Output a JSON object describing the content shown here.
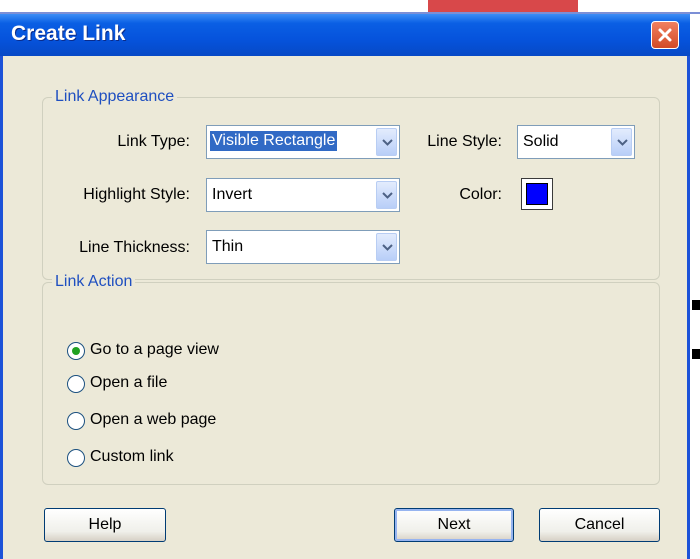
{
  "window": {
    "title": "Create Link"
  },
  "link_appearance": {
    "legend": "Link Appearance",
    "link_type": {
      "label": "Link Type:",
      "value": "Visible Rectangle"
    },
    "line_style": {
      "label": "Line Style:",
      "value": "Solid"
    },
    "highlight_style": {
      "label": "Highlight Style:",
      "value": "Invert"
    },
    "color": {
      "label": "Color:",
      "value": "#0000ff"
    },
    "line_thickness": {
      "label": "Line Thickness:",
      "value": "Thin"
    }
  },
  "link_action": {
    "legend": "Link Action",
    "options": [
      {
        "label": "Go to a page view",
        "selected": true
      },
      {
        "label": "Open a file",
        "selected": false
      },
      {
        "label": "Open a web page",
        "selected": false
      },
      {
        "label": "Custom link",
        "selected": false
      }
    ]
  },
  "buttons": {
    "help": "Help",
    "next": "Next",
    "cancel": "Cancel"
  },
  "icons": {
    "close": "close-icon",
    "dropdown": "chevron-down-icon"
  },
  "colors": {
    "title_bar": "#0653dc",
    "dialog_bg": "#ece9d8",
    "legend_text": "#1f4fc0",
    "swatch": "#0000ff"
  }
}
